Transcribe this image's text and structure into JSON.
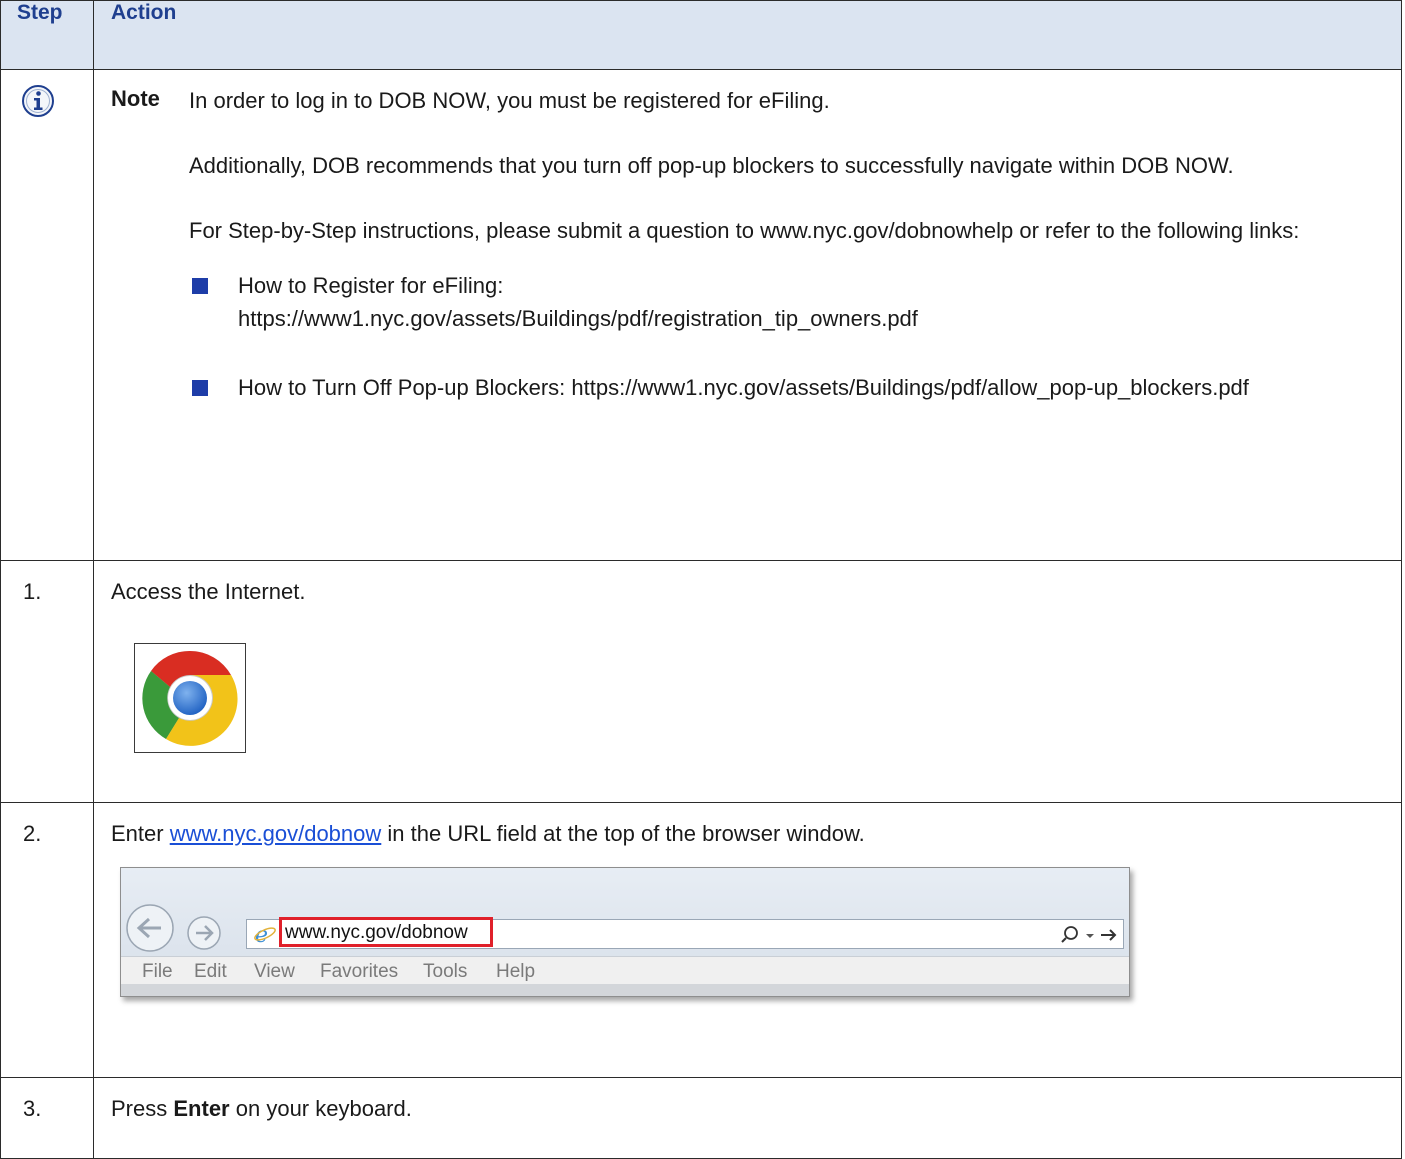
{
  "header": {
    "step": "Step",
    "action": "Action"
  },
  "note": {
    "label": "Note",
    "p1": "In order to log in to DOB NOW, you must be registered for eFiling.",
    "p2": "Additionally, DOB recommends that you turn off pop-up blockers to successfully navigate within DOB NOW.",
    "p3": "For Step-by-Step instructions, please submit a question to www.nyc.gov/dobnowhelp or refer to the following links:",
    "bullets": [
      {
        "title": "How to Register for eFiling:",
        "url": "https://www1.nyc.gov/assets/Buildings/pdf/registration_tip_owners.pdf"
      },
      {
        "title": "How to Turn Off Pop-up Blockers:",
        "url": "https://www1.nyc.gov/assets/Buildings/pdf/allow_pop-up_blockers.pdf"
      }
    ]
  },
  "steps": [
    {
      "num": "1.",
      "text": "Access the Internet."
    },
    {
      "num": "2.",
      "prefix": "Enter",
      "link": "www.nyc.gov/dobnow",
      "suffix": "in the URL field at the top of the browser window."
    },
    {
      "num": "3.",
      "prefix": "Press",
      "bold": "Enter",
      "suffix": "on your keyboard."
    }
  ],
  "browser": {
    "address": "www.nyc.gov/dobnow",
    "menu": [
      "File",
      "Edit",
      "View",
      "Favorites",
      "Tools",
      "Help"
    ],
    "highlight_color": "#e0202a"
  },
  "colors": {
    "header_bg": "#dbe4f1",
    "header_text": "#1f3f8f",
    "bullet": "#1e3da8",
    "link": "#1a4fd6"
  },
  "icons": [
    "info-icon",
    "chrome-icon",
    "back-icon",
    "forward-icon",
    "ie-icon",
    "search-icon",
    "dropdown-icon",
    "go-arrow-icon"
  ]
}
